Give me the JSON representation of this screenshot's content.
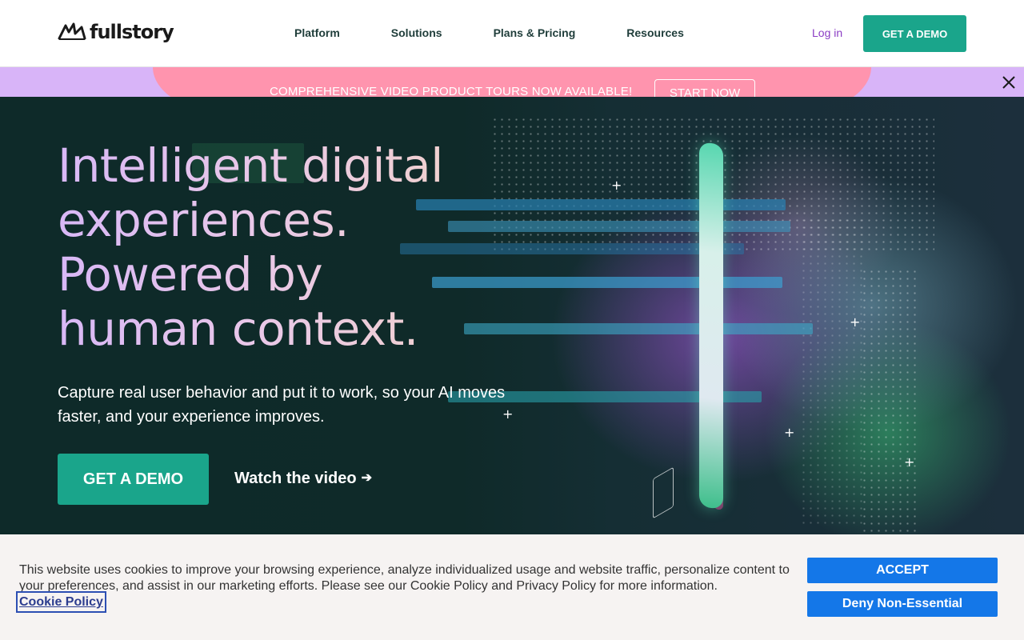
{
  "header": {
    "logo_text": "fullstory",
    "nav": [
      {
        "label": "Platform"
      },
      {
        "label": "Solutions"
      },
      {
        "label": "Plans & Pricing"
      },
      {
        "label": "Resources"
      }
    ],
    "login_label": "Log in",
    "demo_label": "GET A DEMO"
  },
  "announcement": {
    "text": "COMPREHENSIVE VIDEO PRODUCT TOURS NOW AVAILABLE!",
    "cta_label": "START NOW",
    "close_icon": "close-icon"
  },
  "hero": {
    "headline_lines": [
      "Intelligent digital",
      "experiences.",
      "Powered by",
      "human context."
    ],
    "subtext": "Capture real user behavior and put it to work, so your AI moves faster, and your experience improves.",
    "demo_label": "GET A DEMO",
    "watch_label": "Watch the video",
    "watch_icon": "arrow-right-icon"
  },
  "cookie_banner": {
    "text": "This website uses cookies to improve your browsing experience, analyze individualized usage and website traffic, personalize content to your preferences, and assist in our marketing efforts. Please see our Cookie Policy and Privacy Policy for more information.",
    "policy_link": "Cookie Policy",
    "accept_label": "ACCEPT",
    "deny_label": "Deny Non-Essential"
  },
  "colors": {
    "brand_green": "#1aa58b",
    "login_purple": "#8b3dc4",
    "announce_pink": "#ff94ae",
    "announce_lavender": "#d8b4f8",
    "cookie_blue": "#1477e8"
  }
}
